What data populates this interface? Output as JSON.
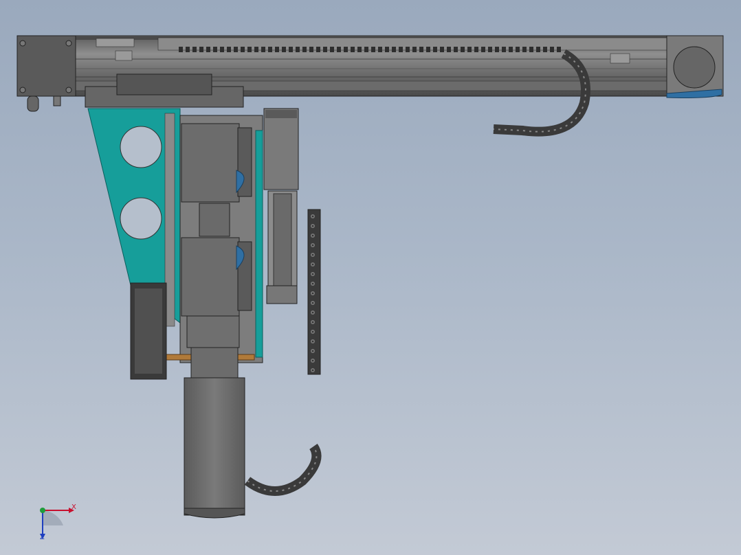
{
  "viewport": {
    "background_top": "#9aa9bd",
    "background_bottom": "#c3cad5"
  },
  "model": {
    "colors": {
      "body": "#6f6f6f",
      "body_dark": "#4f4f4f",
      "body_light": "#8a8a8a",
      "rail": "#7c7c7c",
      "teal": "#169e9a",
      "blue_cap": "#2f6fa3",
      "chain": "#3a3a3a",
      "copper": "#b07a3a"
    }
  },
  "triad": {
    "x_label": "X",
    "z_label": "Z",
    "x_color": "#c8102e",
    "y_color": "#1f9c3a",
    "z_color": "#1f3fbf"
  }
}
